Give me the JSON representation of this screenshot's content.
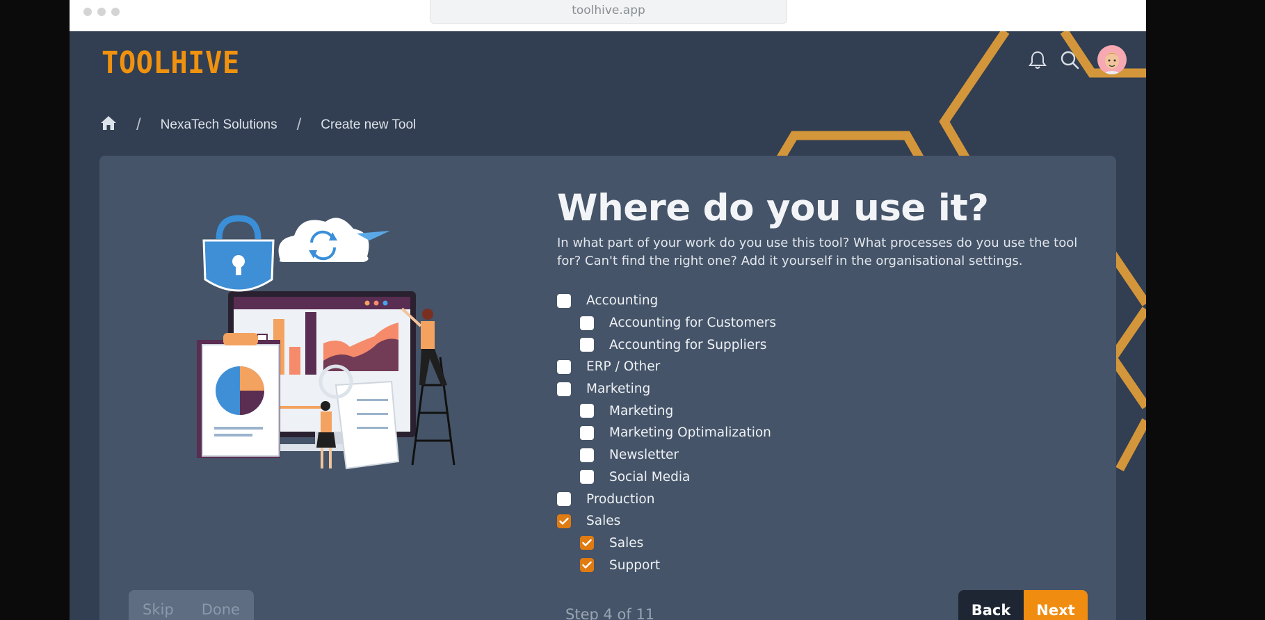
{
  "browser": {
    "url": "toolhive.app"
  },
  "header": {
    "logo": "TOOLHIVE"
  },
  "breadcrumb": {
    "org": "NexaTech Solutions",
    "page": "Create new Tool"
  },
  "main": {
    "title": "Where do you use it?",
    "description": "In what part of your work do you use this tool? What processes do you use the tool for? Can't find the right one? Add it yourself in the organisational settings.",
    "options": [
      {
        "label": "Accounting",
        "checked": false,
        "level": 0
      },
      {
        "label": "Accounting for Customers",
        "checked": false,
        "level": 1
      },
      {
        "label": "Accounting for Suppliers",
        "checked": false,
        "level": 1
      },
      {
        "label": "ERP / Other",
        "checked": false,
        "level": 0
      },
      {
        "label": "Marketing",
        "checked": false,
        "level": 0
      },
      {
        "label": "Marketing",
        "checked": false,
        "level": 1
      },
      {
        "label": "Marketing Optimalization",
        "checked": false,
        "level": 1
      },
      {
        "label": "Newsletter",
        "checked": false,
        "level": 1
      },
      {
        "label": "Social Media",
        "checked": false,
        "level": 1
      },
      {
        "label": "Production",
        "checked": false,
        "level": 0
      },
      {
        "label": "Sales",
        "checked": true,
        "level": 0
      },
      {
        "label": "Sales",
        "checked": true,
        "level": 1
      },
      {
        "label": "Support",
        "checked": true,
        "level": 1
      }
    ]
  },
  "footer": {
    "skip_label": "Skip",
    "done_label": "Done",
    "step_text": "Step 4 of 11",
    "back_label": "Back",
    "next_label": "Next"
  },
  "colors": {
    "accent": "#f08c0f",
    "background": "#323e51",
    "card": "#455468",
    "honeycomb": "#d4963a"
  }
}
